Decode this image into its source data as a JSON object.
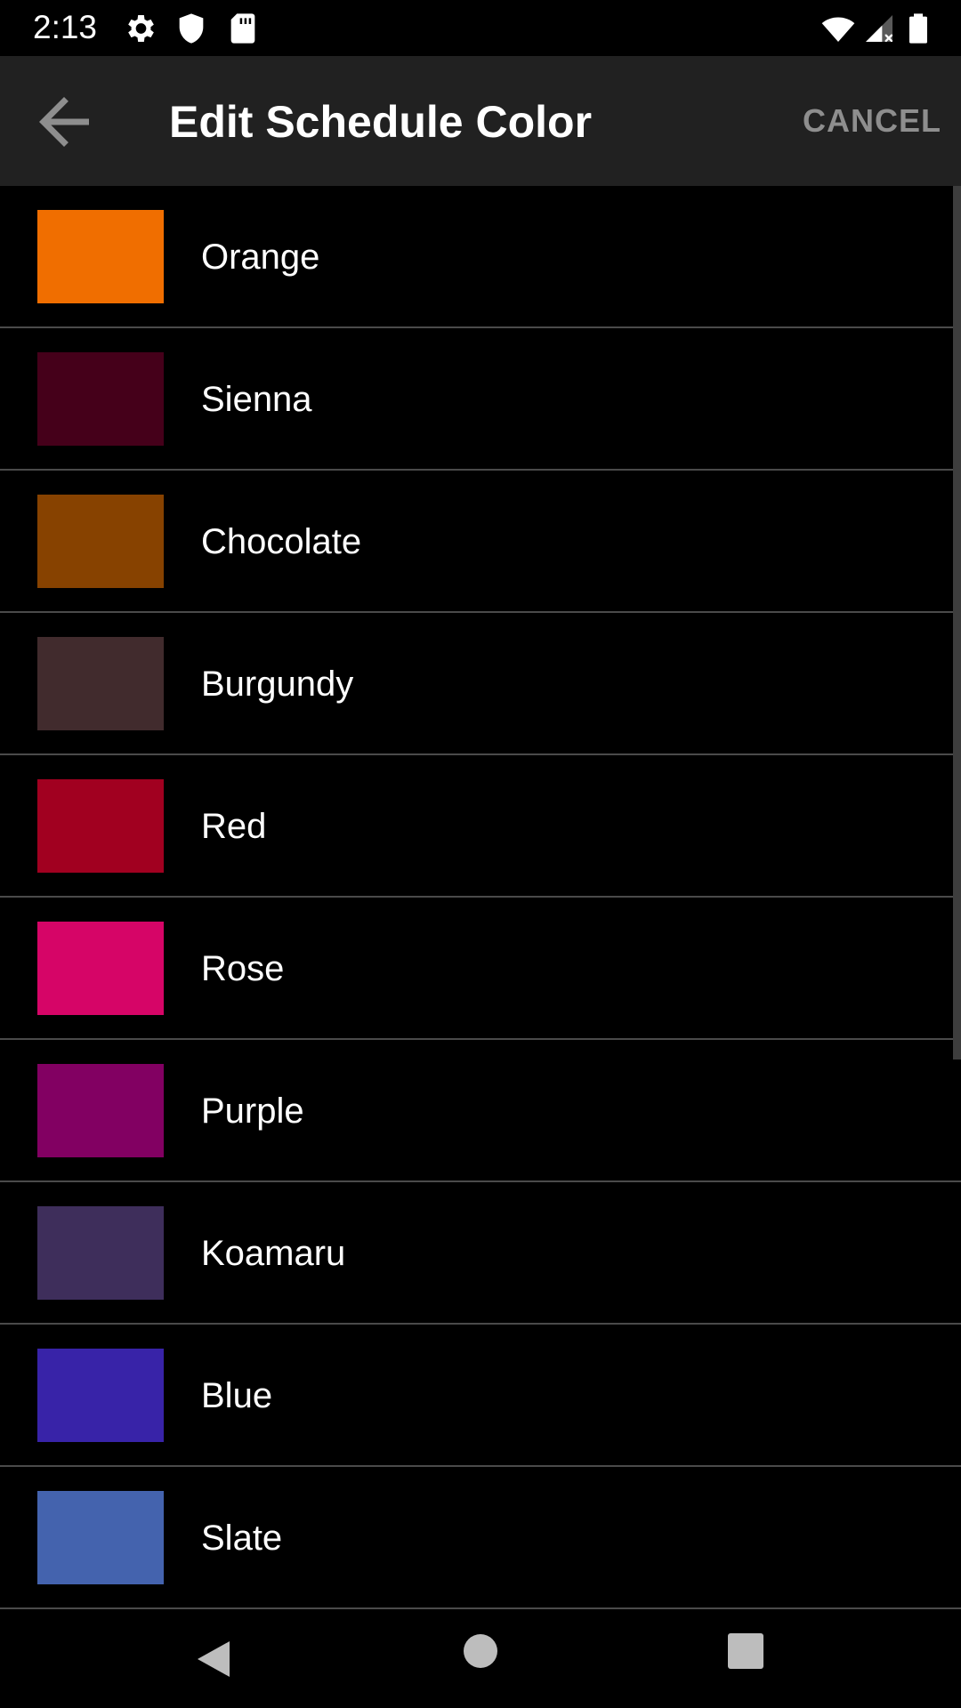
{
  "status_bar": {
    "time": "2:13",
    "icons_left": [
      "settings-icon",
      "shield-icon",
      "sd-card-icon"
    ],
    "icons_right": [
      "wifi-icon",
      "signal-icon",
      "battery-icon"
    ]
  },
  "app_bar": {
    "back_icon": "arrow-back-icon",
    "title": "Edit Schedule Color",
    "cancel_label": "CANCEL"
  },
  "colors": [
    {
      "name": "Orange",
      "hex": "#F06E00"
    },
    {
      "name": "Sienna",
      "hex": "#45001A"
    },
    {
      "name": "Chocolate",
      "hex": "#874200"
    },
    {
      "name": "Burgundy",
      "hex": "#412B2D"
    },
    {
      "name": "Red",
      "hex": "#A10020"
    },
    {
      "name": "Rose",
      "hex": "#D60567"
    },
    {
      "name": "Purple",
      "hex": "#820062"
    },
    {
      "name": "Koamaru",
      "hex": "#3E2E5B"
    },
    {
      "name": "Blue",
      "hex": "#3823A8"
    },
    {
      "name": "Slate",
      "hex": "#4463AE"
    }
  ],
  "nav_bar": {
    "icons": [
      "nav-back-icon",
      "nav-home-icon",
      "nav-recents-icon"
    ]
  },
  "theme": {
    "background": "#000000",
    "app_bar": "#212121",
    "divider": "#4A4A4A",
    "cancel_text": "#8E8E8E"
  }
}
